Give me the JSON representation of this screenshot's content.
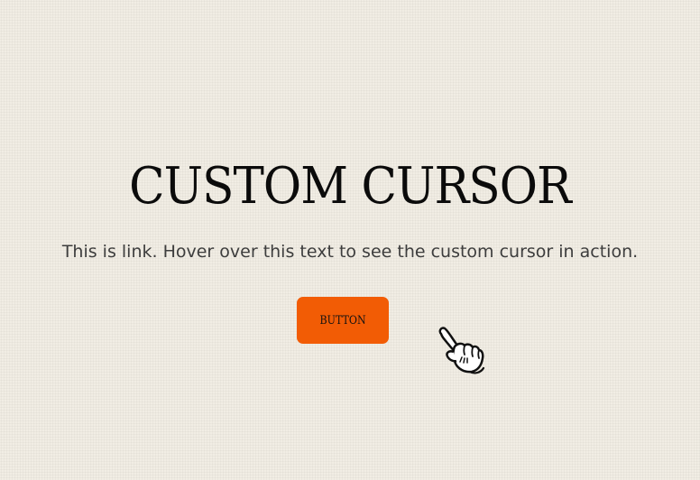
{
  "page": {
    "title": "CUSTOM CURSOR",
    "subtitle_link": "This is link.",
    "subtitle_rest": " Hover over this text to see the custom cursor in action.",
    "button_label": "BUTTON"
  },
  "colors": {
    "background": "#f1ede4",
    "button": "#f25c05",
    "title": "#0b0b0b",
    "text": "#3d3d3d"
  },
  "cursor": {
    "icon": "cartoon-pointing-hand-icon"
  }
}
